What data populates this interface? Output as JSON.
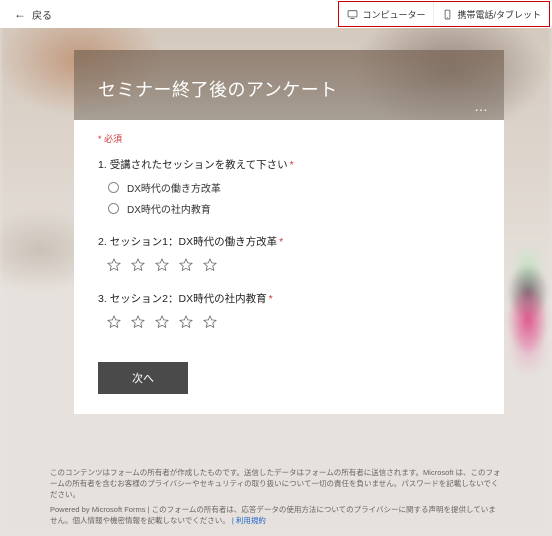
{
  "topbar": {
    "back_label": "戻る",
    "device_computer": "コンピューター",
    "device_mobile": "携帯電話/タブレット"
  },
  "form": {
    "title": "セミナー終了後のアンケート",
    "more": "…",
    "required_label": "必須",
    "questions": [
      {
        "number": "1",
        "text": "受講されたセッションを教えて下さい",
        "required": true,
        "type": "radio",
        "options": [
          "DX時代の働き方改革",
          "DX時代の社内教育"
        ]
      },
      {
        "number": "2",
        "text": "セッション1：DX時代の働き方改革",
        "required": true,
        "type": "rating",
        "stars": 5
      },
      {
        "number": "3",
        "text": "セッション2：DX時代の社内教育",
        "required": true,
        "type": "rating",
        "stars": 5
      }
    ],
    "next_label": "次へ"
  },
  "footer": {
    "disclaimer": "このコンテンツはフォームの所有者が作成したものです。送信したデータはフォームの所有者に送信されます。Microsoft は、このフォームの所有者を含むお客様のプライバシーやセキュリティの取り扱いについて一切の責任を負いません。パスワードを記載しないでください。",
    "powered": "Powered by Microsoft Forms",
    "privacy_line": "このフォームの所有者は、応答データの使用方法についてのプライバシーに関する声明を提供していません。個人情報や機密情報を記載しないでください。",
    "link_label": "| 利用規約"
  }
}
